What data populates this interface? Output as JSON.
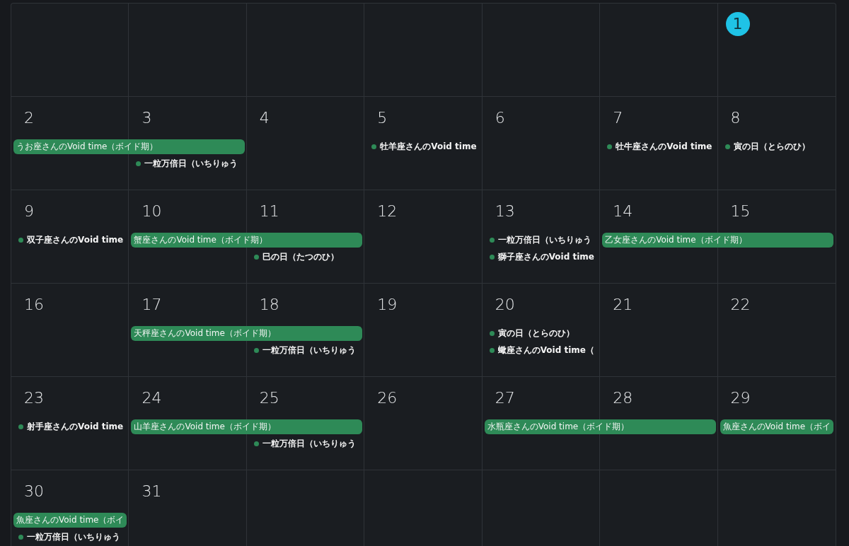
{
  "weeks": [
    {
      "days": [
        {
          "kind": "blank"
        },
        {
          "kind": "blank"
        },
        {
          "kind": "blank"
        },
        {
          "kind": "blank"
        },
        {
          "kind": "blank"
        },
        {
          "kind": "blank"
        },
        {
          "kind": "date",
          "number": "1",
          "today": true
        }
      ]
    },
    {
      "days": [
        {
          "kind": "date",
          "number": "2",
          "today": false,
          "events": [
            {
              "kind": "bar",
              "title": "うお座さんのVoid time（ボイド期）",
              "spans_next_day": true
            }
          ]
        },
        {
          "kind": "date",
          "number": "3",
          "today": false,
          "events": [
            {
              "kind": "dot",
              "title": "一粒万倍日（いちりゅう"
            }
          ]
        },
        {
          "kind": "date",
          "number": "4",
          "today": false
        },
        {
          "kind": "date",
          "number": "5",
          "today": false,
          "events": [
            {
              "kind": "dot",
              "title": "牡羊座さんのVoid time"
            }
          ]
        },
        {
          "kind": "date",
          "number": "6",
          "today": false
        },
        {
          "kind": "date",
          "number": "7",
          "today": false,
          "events": [
            {
              "kind": "dot",
              "title": "牡牛座さんのVoid time"
            }
          ]
        },
        {
          "kind": "date",
          "number": "8",
          "today": false,
          "events": [
            {
              "kind": "dot",
              "title": "寅の日（とらのひ）"
            }
          ]
        }
      ]
    },
    {
      "days": [
        {
          "kind": "date",
          "number": "9",
          "today": false,
          "events": [
            {
              "kind": "dot",
              "title": "双子座さんのVoid time"
            }
          ]
        },
        {
          "kind": "date",
          "number": "10",
          "today": false,
          "events": [
            {
              "kind": "bar",
              "title": "蟹座さんのVoid time（ボイド期）",
              "spans_next_day": true
            }
          ]
        },
        {
          "kind": "date",
          "number": "11",
          "today": false,
          "events": [
            {
              "kind": "dot",
              "title": "巳の日（たつのひ）"
            }
          ]
        },
        {
          "kind": "date",
          "number": "12",
          "today": false
        },
        {
          "kind": "date",
          "number": "13",
          "today": false,
          "events": [
            {
              "kind": "dot",
              "title": "一粒万倍日（いちりゅう"
            },
            {
              "kind": "dot",
              "title": "獅子座さんのVoid time"
            }
          ]
        },
        {
          "kind": "date",
          "number": "14",
          "today": false,
          "events": [
            {
              "kind": "bar",
              "title": "乙女座さんのVoid time（ボイド期）",
              "spans_next_day": true
            }
          ]
        },
        {
          "kind": "date",
          "number": "15",
          "today": false
        }
      ]
    },
    {
      "days": [
        {
          "kind": "date",
          "number": "16",
          "today": false
        },
        {
          "kind": "date",
          "number": "17",
          "today": false,
          "events": [
            {
              "kind": "bar",
              "title": "天秤座さんのVoid time（ボイド期）",
              "spans_next_day": true
            }
          ]
        },
        {
          "kind": "date",
          "number": "18",
          "today": false,
          "events": [
            {
              "kind": "dot",
              "title": "一粒万倍日（いちりゅう"
            }
          ]
        },
        {
          "kind": "date",
          "number": "19",
          "today": false
        },
        {
          "kind": "date",
          "number": "20",
          "today": false,
          "events": [
            {
              "kind": "dot",
              "title": "寅の日（とらのひ）"
            },
            {
              "kind": "dot",
              "title": "蠍座さんのVoid time（"
            }
          ]
        },
        {
          "kind": "date",
          "number": "21",
          "today": false
        },
        {
          "kind": "date",
          "number": "22",
          "today": false
        }
      ]
    },
    {
      "days": [
        {
          "kind": "date",
          "number": "23",
          "today": false,
          "events": [
            {
              "kind": "dot",
              "title": "射手座さんのVoid time"
            }
          ]
        },
        {
          "kind": "date",
          "number": "24",
          "today": false,
          "events": [
            {
              "kind": "bar",
              "title": "山羊座さんのVoid time（ボイド期）",
              "spans_next_day": true
            }
          ]
        },
        {
          "kind": "date",
          "number": "25",
          "today": false,
          "events": [
            {
              "kind": "dot",
              "title": "一粒万倍日（いちりゅう"
            }
          ]
        },
        {
          "kind": "date",
          "number": "26",
          "today": false
        },
        {
          "kind": "date",
          "number": "27",
          "today": false,
          "events": [
            {
              "kind": "bar",
              "title": "水瓶座さんのVoid time（ボイド期）",
              "spans_next_day": true
            }
          ]
        },
        {
          "kind": "date",
          "number": "28",
          "today": false
        },
        {
          "kind": "date",
          "number": "29",
          "today": false,
          "events": [
            {
              "kind": "bar",
              "title": "魚座さんのVoid time（ボイ",
              "spans_next_day": false
            }
          ]
        }
      ]
    },
    {
      "days": [
        {
          "kind": "date",
          "number": "30",
          "today": false,
          "events": [
            {
              "kind": "bar",
              "title": "魚座さんのVoid time（ボイ",
              "spans_next_day": false
            },
            {
              "kind": "dot",
              "title": "一粒万倍日（いちりゅう"
            }
          ]
        },
        {
          "kind": "date",
          "number": "31",
          "today": false
        },
        {
          "kind": "blank"
        },
        {
          "kind": "blank"
        },
        {
          "kind": "blank"
        },
        {
          "kind": "blank"
        },
        {
          "kind": "blank"
        }
      ]
    }
  ]
}
